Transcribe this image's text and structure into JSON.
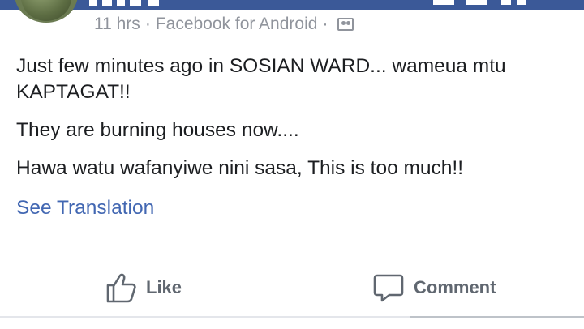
{
  "post": {
    "timestamp": "11 hrs",
    "source": "Facebook for Android",
    "separator": "·",
    "audience_icon": "friends-icon",
    "paragraphs": [
      "Just few minutes ago in SOSIAN WARD... wameua mtu KAPTAGAT!!",
      "They are burning houses now....",
      "Hawa watu wafanyiwe nini sasa, This is too much!!"
    ],
    "see_translation": "See Translation"
  },
  "actions": {
    "like_label": "Like",
    "comment_label": "Comment"
  },
  "colors": {
    "brand": "#3b5998",
    "link": "#4267b2",
    "meta": "#90949c",
    "action": "#606770"
  }
}
